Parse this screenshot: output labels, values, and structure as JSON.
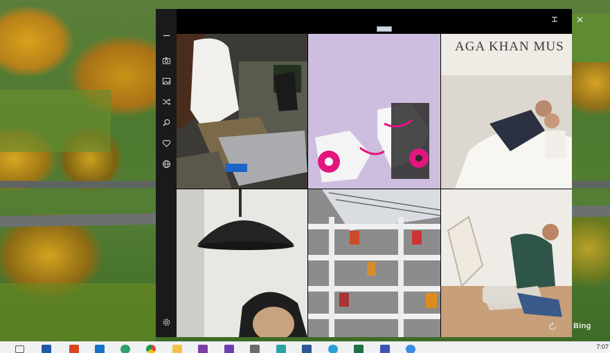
{
  "window": {
    "minimize_icon": "minimize-icon",
    "close_icon": "close-icon"
  },
  "rail": {
    "items": [
      {
        "name": "menu",
        "icon": "hamburger-icon"
      },
      {
        "name": "camera",
        "icon": "camera-icon"
      },
      {
        "name": "wallpaper",
        "icon": "image-icon"
      },
      {
        "name": "shuffle",
        "icon": "shuffle-icon"
      },
      {
        "name": "search",
        "icon": "search-icon"
      },
      {
        "name": "favorites",
        "icon": "heart-icon"
      },
      {
        "name": "web",
        "icon": "globe-icon"
      },
      {
        "name": "settings",
        "icon": "gear-icon"
      }
    ]
  },
  "tiles": [
    {
      "sign_text": ""
    },
    {
      "sign_text": ""
    },
    {
      "sign_text": "AGA KHAN MUS"
    },
    {
      "sign_text": ""
    },
    {
      "sign_text": ""
    },
    {
      "sign_text": ""
    }
  ],
  "overlay": {
    "brand": "Bing",
    "refresh_icon": "refresh-icon"
  },
  "taskbar": {
    "clock": "7:07",
    "apps": [
      "task-view",
      "store",
      "office",
      "mail",
      "edge",
      "chrome",
      "explorer",
      "onenote",
      "visual-studio",
      "files",
      "azure",
      "word",
      "telegram",
      "excel",
      "save",
      "app-blue"
    ]
  },
  "colors": {
    "accent": "#e3157f",
    "rail_bg": "#1a1a1a",
    "window_bg": "#000000"
  }
}
